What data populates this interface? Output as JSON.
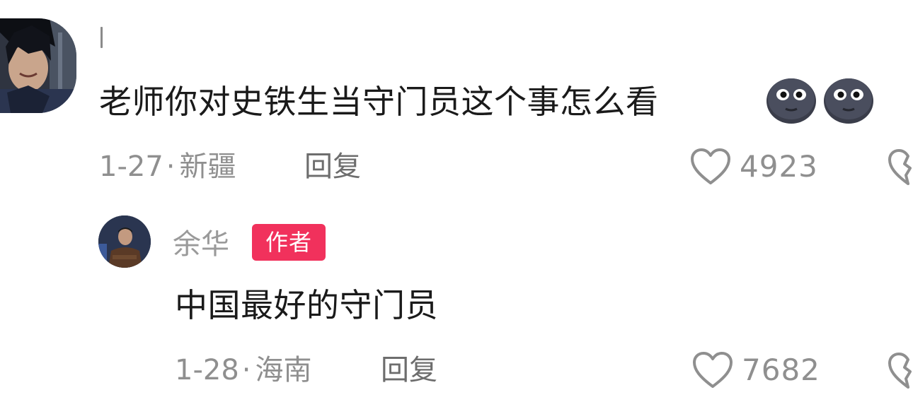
{
  "colors": {
    "text_primary": "#1a1a1a",
    "text_meta": "#8f8f8f",
    "badge_bg": "#f1315c",
    "badge_text": "#ffffff"
  },
  "comments": [
    {
      "username": "",
      "avatar": "anime-character-avatar",
      "text": "老师你对史铁生当守门员这个事怎么看",
      "emojis": [
        "dark-face-emoji",
        "dark-face-emoji"
      ],
      "date": "1-27",
      "location": "新疆",
      "reply_label": "回复",
      "likes": "4923",
      "like_icon": "heart-outline-icon",
      "dislike_icon": "broken-heart-icon"
    },
    {
      "username": "余华",
      "badge": "作者",
      "avatar": "author-photo-avatar",
      "text": "中国最好的守门员",
      "date": "1-28",
      "location": "海南",
      "reply_label": "回复",
      "likes": "7682",
      "like_icon": "heart-outline-icon",
      "dislike_icon": "broken-heart-icon"
    }
  ],
  "separator_dot": "·"
}
